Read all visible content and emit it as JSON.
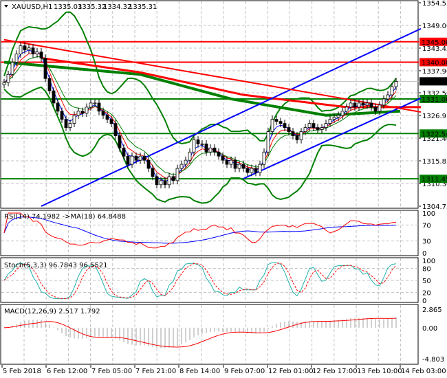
{
  "chart_data": {
    "type": "candlestick",
    "header": {
      "symbol": "XAUUSD,H1",
      "open": "1335.03",
      "high": "1335.32",
      "low": "1334.32",
      "close": "1335.31"
    },
    "price_axis": {
      "min": 1304.75,
      "max": 1354.55,
      "ticks": [
        "1354.55",
        "1349.00",
        "1343.45",
        "1337.90",
        "1332.50",
        "1326.95",
        "1321.40",
        "1315.85",
        "1310.30",
        "1304.75"
      ]
    },
    "x_labels": [
      "5 Feb 2018",
      "6 Feb 12:00",
      "7 Feb 05:00",
      "7 Feb 21:00",
      "8 Feb 14:00",
      "9 Feb 07:00",
      "12 Feb 01:00",
      "12 Feb 17:00",
      "13 Feb 10:00",
      "14 Feb 03:00"
    ],
    "closes": [
      1335,
      1337,
      1340,
      1342,
      1344,
      1343,
      1343.5,
      1342,
      1342.5,
      1341,
      1336,
      1333,
      1330,
      1328,
      1326,
      1324,
      1325,
      1327,
      1328,
      1327.5,
      1329,
      1330,
      1330,
      1328,
      1327,
      1326,
      1325,
      1322,
      1319,
      1317,
      1315,
      1317,
      1316,
      1317,
      1316,
      1314,
      1312,
      1310,
      1311,
      1310,
      1312,
      1311,
      1314,
      1315,
      1316,
      1318,
      1321,
      1320,
      1320,
      1318,
      1319,
      1318,
      1317,
      1316,
      1315,
      1316,
      1314,
      1315,
      1314,
      1313,
      1314,
      1313,
      1315,
      1318,
      1323,
      1326,
      1325.5,
      1325,
      1324,
      1323,
      1322,
      1321,
      1323,
      1324,
      1325,
      1324,
      1323.5,
      1324,
      1325,
      1326,
      1326.5,
      1327,
      1328,
      1329,
      1330,
      1329,
      1330,
      1329.5,
      1330,
      1329,
      1328,
      1329.5,
      1331,
      1332,
      1334,
      1335.3
    ],
    "levels": [
      {
        "price": 1345.0,
        "label": "1345.00",
        "color": "#ff0000"
      },
      {
        "price": 1340.0,
        "label": "1340.00",
        "color": "#ff0000"
      },
      {
        "price": 1331.0,
        "label": "1331.00",
        "color": "#008000"
      },
      {
        "price": 1322.54,
        "label": "1322.54",
        "color": "#008000"
      },
      {
        "price": 1311.45,
        "label": "1311.45",
        "color": "#008000"
      }
    ],
    "current_price": {
      "price": 1335.31,
      "label": "1335.31"
    },
    "trendlines": [
      {
        "color": "#0000ff",
        "points": [
          [
            9,
            1304.75
          ],
          [
            101,
            1348.2
          ]
        ]
      },
      {
        "color": "#0000ff",
        "points": [
          [
            58,
            1311.5
          ],
          [
            101,
            1331.2
          ]
        ]
      },
      {
        "color": "#ff0000",
        "points": [
          [
            0,
            1345.5
          ],
          [
            101,
            1327.8
          ]
        ]
      }
    ],
    "slow_ma_red": [
      [
        9,
        1341
      ],
      [
        33,
        1337.5
      ],
      [
        58,
        1332
      ],
      [
        83,
        1329
      ],
      [
        101,
        1329
      ]
    ],
    "slow_ma_green": [
      [
        0,
        1340
      ],
      [
        33,
        1337
      ],
      [
        55,
        1331
      ],
      [
        78,
        1327
      ],
      [
        96,
        1328
      ]
    ],
    "rsi": {
      "label": "RSI(14) 74.1982  ->MA(18) 64.8488",
      "ticks": [
        "100",
        "70",
        "30",
        "0"
      ]
    },
    "stoch": {
      "label": "Stoch(5,3,3) 96.7843 96.5521",
      "ticks": [
        "100",
        "80",
        "50",
        "20",
        "0"
      ]
    },
    "macd": {
      "label": "MACD(12,26,9) 2.517 1.792",
      "ticks": [
        "2.865",
        "0.00",
        "-4.803"
      ],
      "max": 2.865,
      "min": -4.803
    }
  }
}
